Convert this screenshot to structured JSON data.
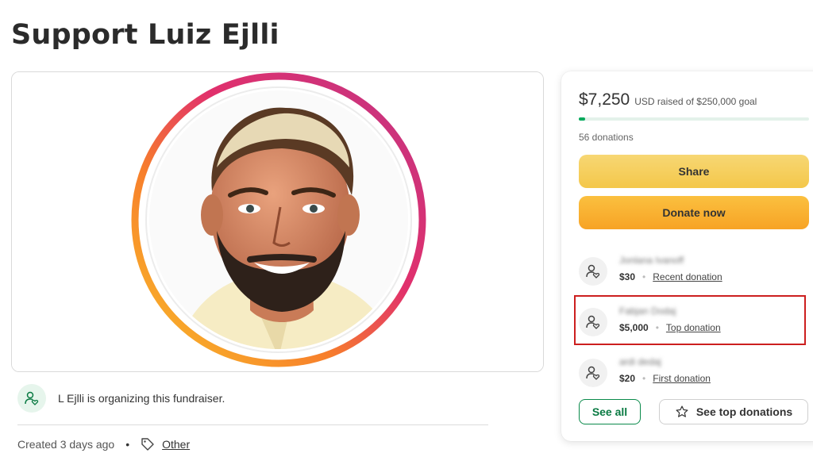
{
  "page": {
    "title": "Support Luiz Ejlli"
  },
  "hero": {
    "alt_subject": "portrait-illustration"
  },
  "organizer": {
    "text": "L Ejlli is organizing this fundraiser."
  },
  "meta": {
    "created": "Created 3 days ago",
    "dot": "•",
    "category": "Other"
  },
  "summary": {
    "raised": "$7,250",
    "raised_suffix": "USD raised of $250,000 goal",
    "progress_fraction": 0.029,
    "donations_count": "56 donations"
  },
  "actions": {
    "share": "Share",
    "donate": "Donate now"
  },
  "donors": [
    {
      "name": "Jonlana Ivanoff",
      "amount": "$30",
      "label": "Recent donation"
    },
    {
      "name": "Fabjan Dodaj",
      "amount": "$5,000",
      "label": "Top donation"
    },
    {
      "name": "ardi dedaj",
      "amount": "$20",
      "label": "First donation"
    }
  ],
  "footer_buttons": {
    "see_all": "See all",
    "see_top": "See top donations"
  },
  "colors": {
    "accent_green": "#02a95c",
    "highlight_red": "#cc1f1f",
    "share_yellow": "#f6d05e",
    "donate_orange": "#f9ad2f"
  }
}
